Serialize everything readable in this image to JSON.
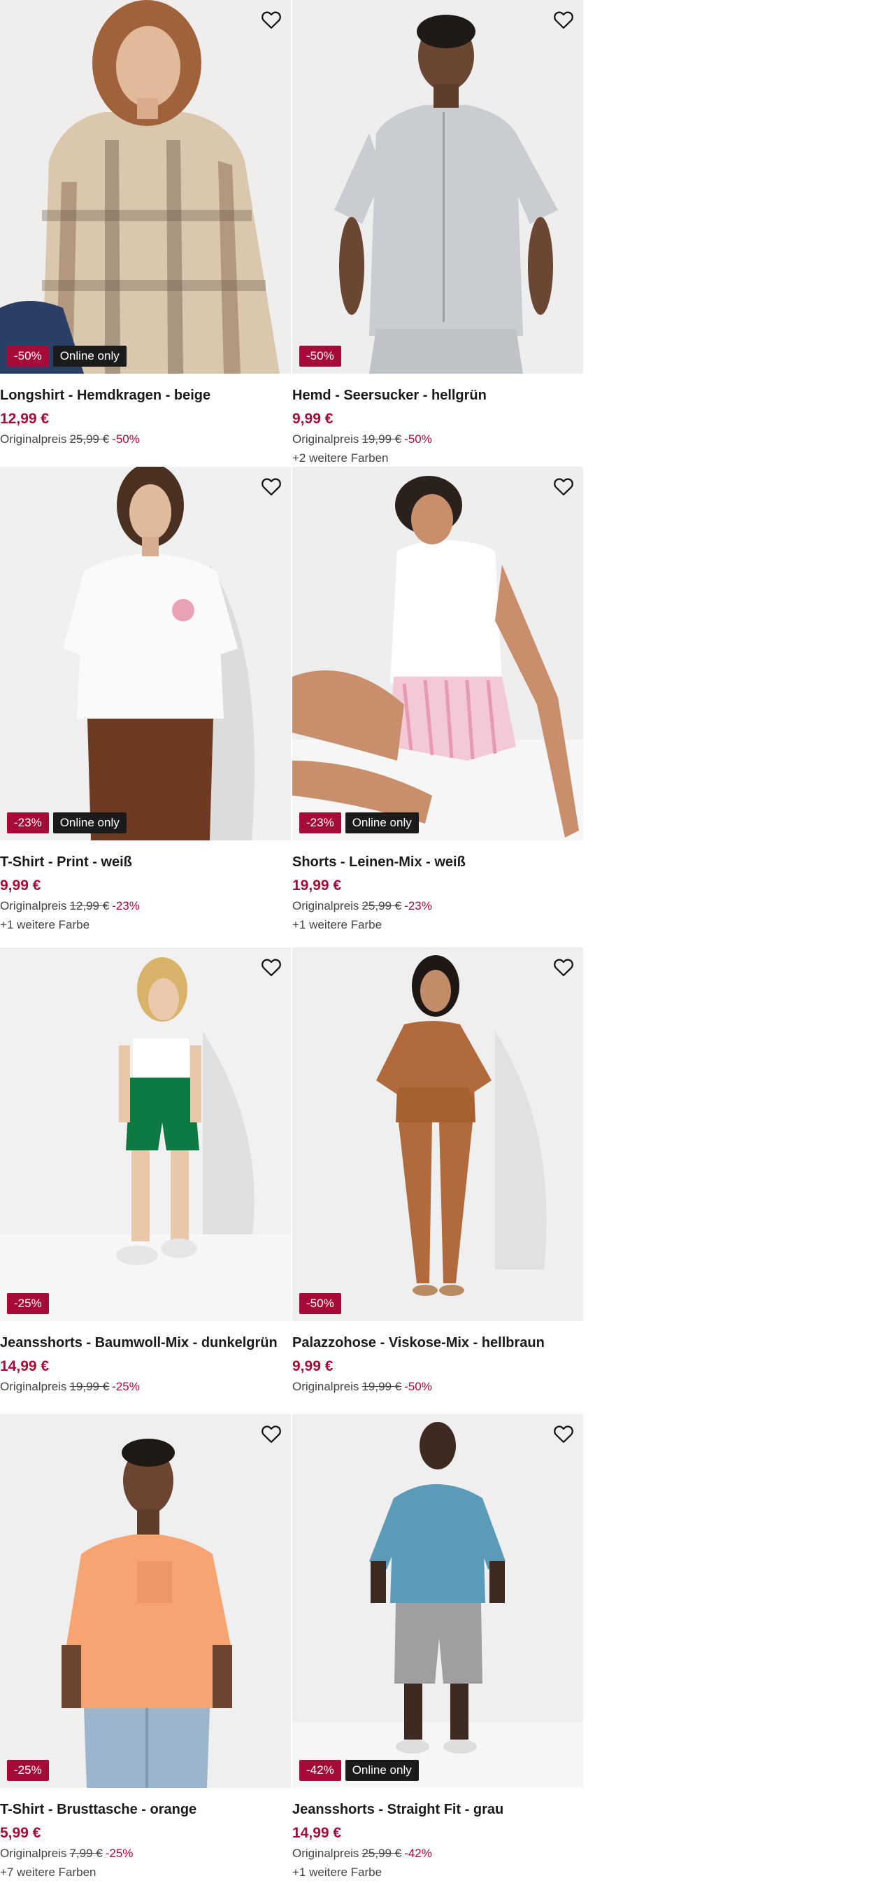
{
  "products": [
    {
      "title": "Longshirt - Hemdkragen - beige",
      "price": "12,99 €",
      "orig_label": "Originalpreis",
      "orig_price": "25,99 €",
      "discount": "-50%",
      "badge_sale": "-50%",
      "badge_online": "Online only",
      "colors": ""
    },
    {
      "title": "Hemd - Seersucker - hellgrün",
      "price": "9,99 €",
      "orig_label": "Originalpreis",
      "orig_price": "19,99 €",
      "discount": "-50%",
      "badge_sale": "-50%",
      "badge_online": "",
      "colors": "+2 weitere Farben"
    },
    {
      "title": "T-Shirt - Print - weiß",
      "price": "9,99 €",
      "orig_label": "Originalpreis",
      "orig_price": "12,99 €",
      "discount": "-23%",
      "badge_sale": "-23%",
      "badge_online": "Online only",
      "colors": "+1 weitere Farbe"
    },
    {
      "title": "Shorts - Leinen-Mix - weiß",
      "price": "19,99 €",
      "orig_label": "Originalpreis",
      "orig_price": "25,99 €",
      "discount": "-23%",
      "badge_sale": "-23%",
      "badge_online": "Online only",
      "colors": "+1 weitere Farbe"
    },
    {
      "title": "Jeansshorts - Baumwoll-Mix - dunkelgrün",
      "price": "14,99 €",
      "orig_label": "Originalpreis",
      "orig_price": "19,99 €",
      "discount": "-25%",
      "badge_sale": "-25%",
      "badge_online": "",
      "colors": ""
    },
    {
      "title": "Palazzohose - Viskose-Mix - hellbraun",
      "price": "9,99 €",
      "orig_label": "Originalpreis",
      "orig_price": "19,99 €",
      "discount": "-50%",
      "badge_sale": "-50%",
      "badge_online": "",
      "colors": ""
    },
    {
      "title": "T-Shirt - Brusttasche - orange",
      "price": "5,99 €",
      "orig_label": "Originalpreis",
      "orig_price": "7,99 €",
      "discount": "-25%",
      "badge_sale": "-25%",
      "badge_online": "",
      "colors": "+7 weitere Farben"
    },
    {
      "title": "Jeansshorts - Straight Fit - grau",
      "price": "14,99 €",
      "orig_label": "Originalpreis",
      "orig_price": "25,99 €",
      "discount": "-42%",
      "badge_sale": "-42%",
      "badge_online": "Online only",
      "colors": "+1 weitere Farbe"
    }
  ],
  "icons": {
    "favorite": "heart-outline-icon"
  },
  "colors": {
    "sale": "#a60b38",
    "online_badge": "#1b1b1b",
    "text": "#1a1a1a"
  }
}
